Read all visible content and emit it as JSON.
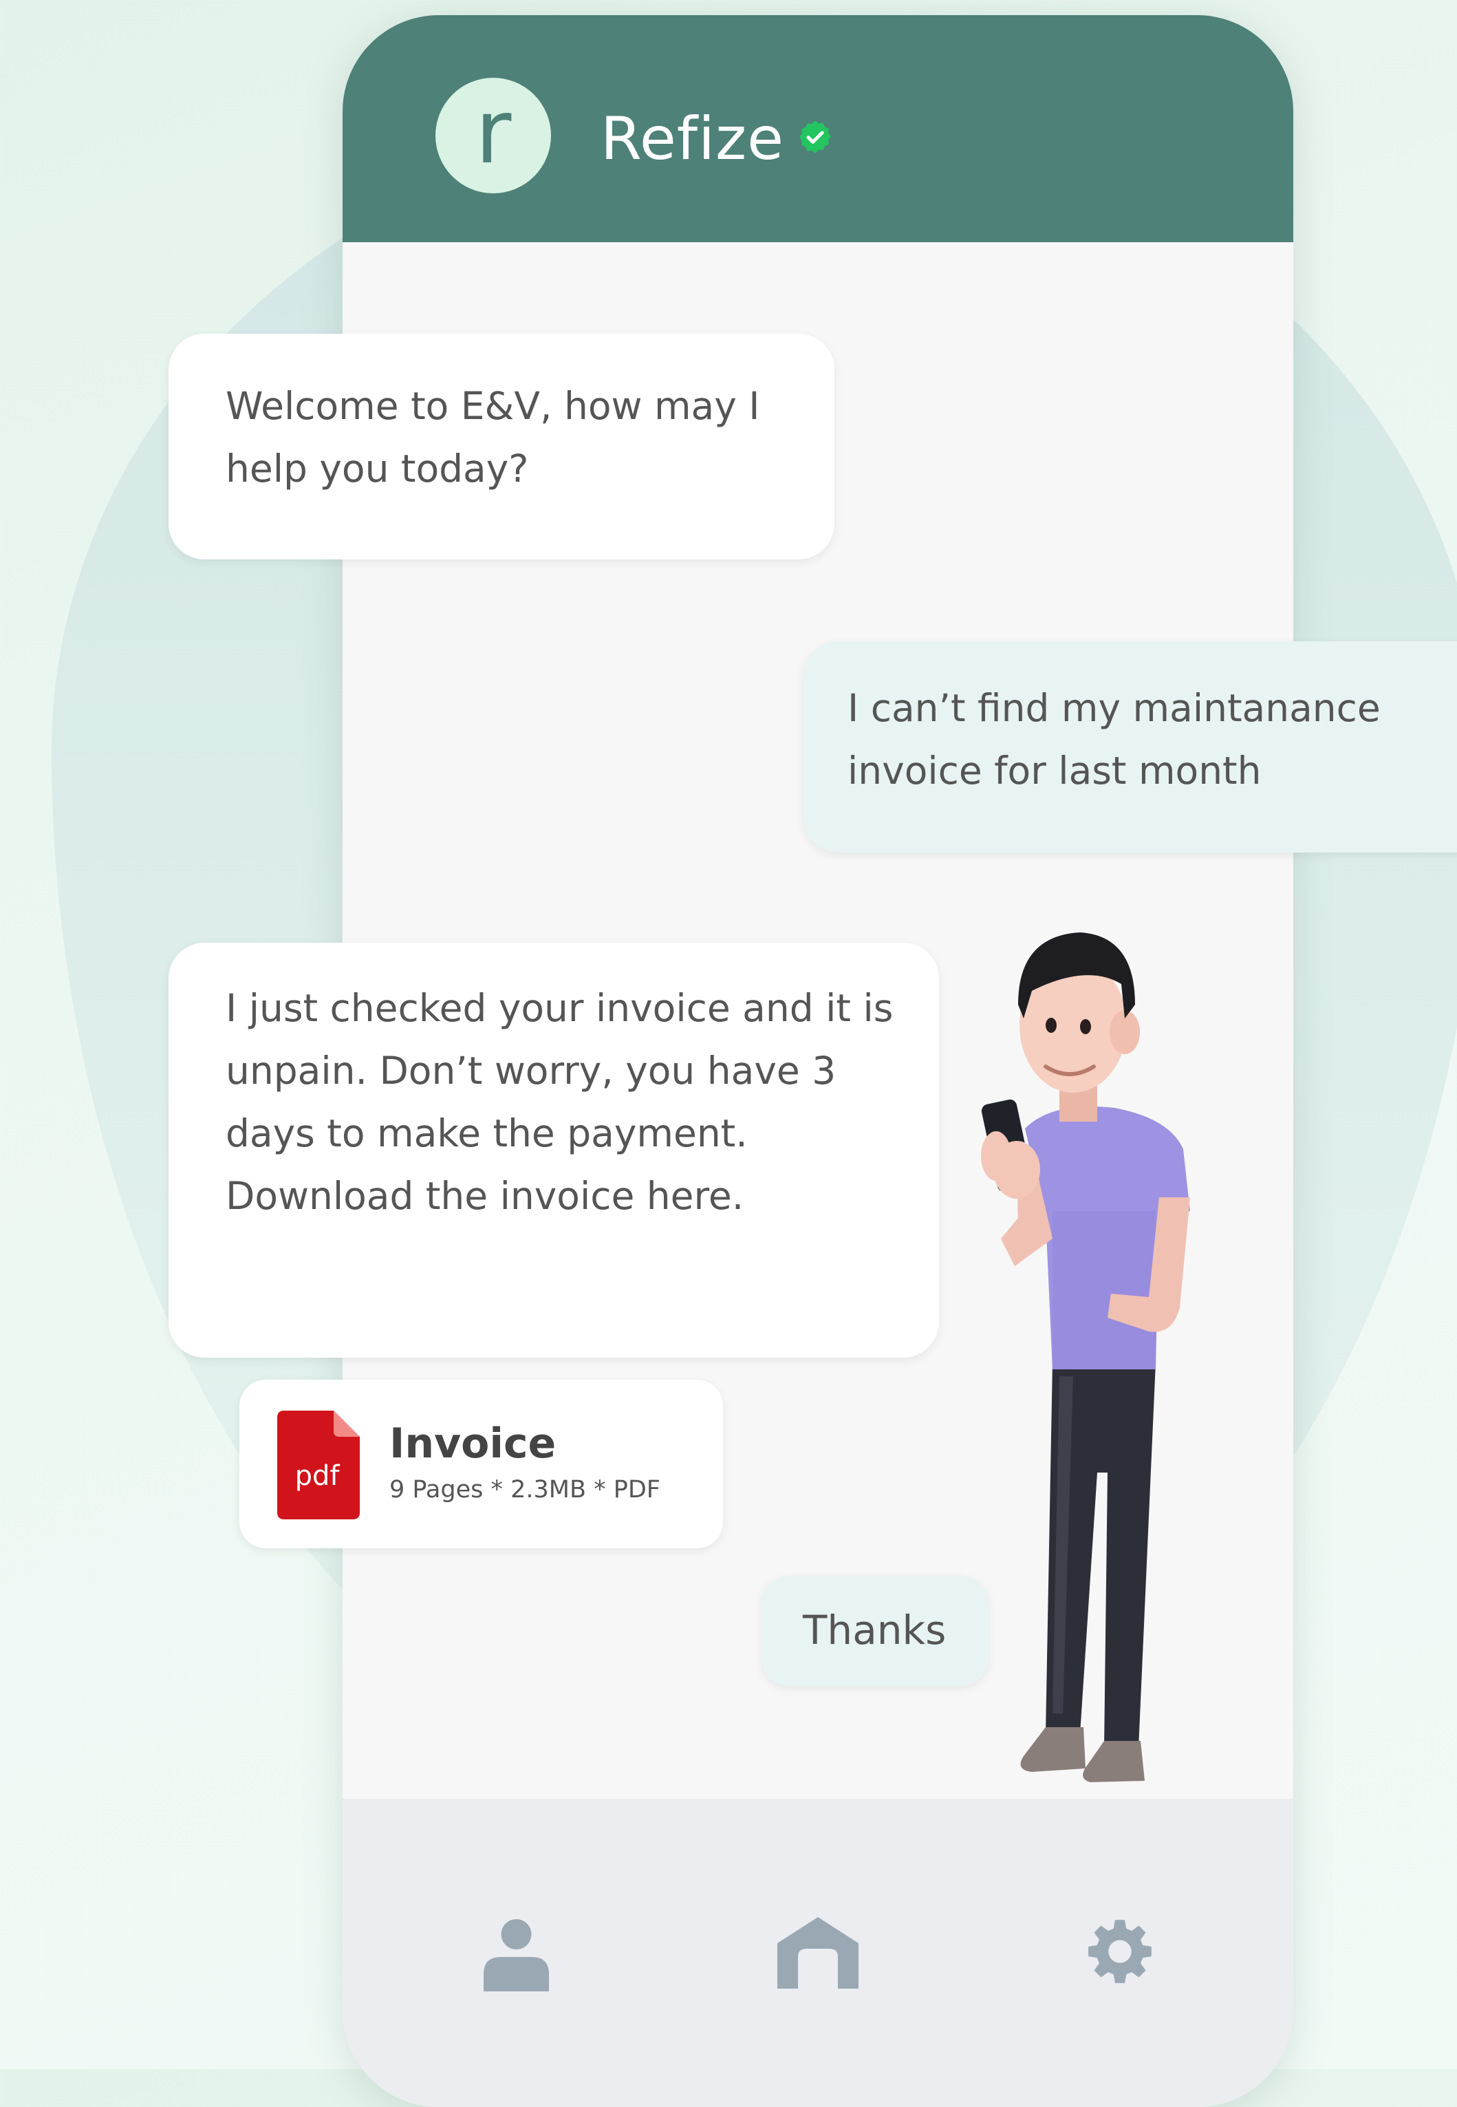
{
  "header": {
    "avatar_letter": "r",
    "brand_name": "Refize",
    "verified_icon": "verified-check-icon"
  },
  "messages": [
    {
      "from": "bot",
      "text": "Welcome to E&V, how may I help you today?"
    },
    {
      "from": "user",
      "text": "I can’t find my maintanance invoice for last month"
    },
    {
      "from": "bot",
      "text": "I just checked your invoice and it is unpain. Don’t worry, you have 3 days to make the payment. Download the invoice here."
    },
    {
      "from": "user",
      "text": "Thanks"
    }
  ],
  "attachment": {
    "icon_label": "pdf",
    "name": "Invoice",
    "meta": "9 Pages * 2.3MB * PDF"
  },
  "nav": {
    "items": [
      {
        "icon": "person-icon"
      },
      {
        "icon": "home-icon"
      },
      {
        "icon": "gear-icon"
      }
    ]
  },
  "colors": {
    "header": "#4e8178",
    "avatar_bg": "#d9f2e3",
    "verified": "#22c55e",
    "pdf_red": "#d1131b",
    "nav_icon": "#9aa8b4"
  }
}
